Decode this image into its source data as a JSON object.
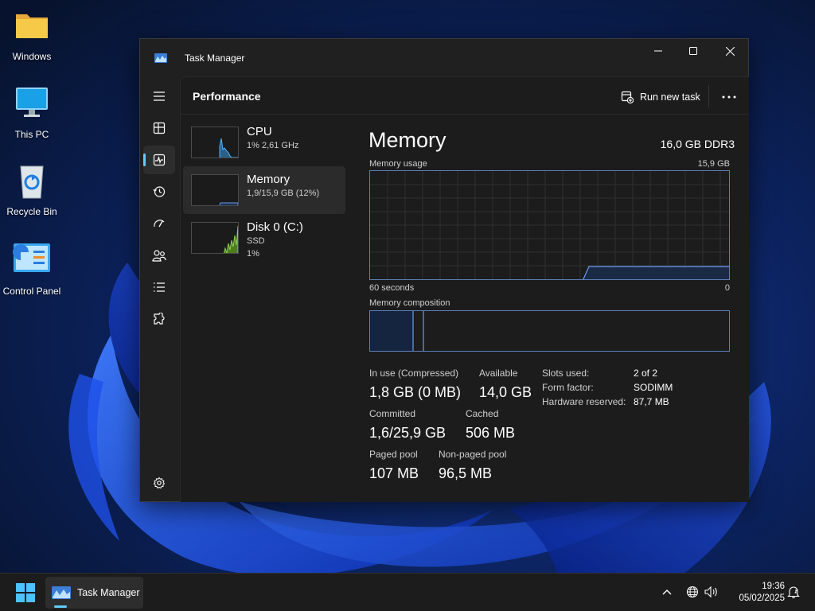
{
  "desktop": {
    "icons": [
      {
        "label": "Windows",
        "icon": "folder-icon"
      },
      {
        "label": "This PC",
        "icon": "monitor-icon"
      },
      {
        "label": "Recycle Bin",
        "icon": "recycle-bin-icon"
      },
      {
        "label": "Control Panel",
        "icon": "control-panel-icon"
      }
    ]
  },
  "window": {
    "title": "Task Manager",
    "page_title": "Performance",
    "run_new_task": "Run new task",
    "nav": [
      "menu-icon",
      "processes-icon",
      "performance-icon",
      "app-history-icon",
      "startup-apps-icon",
      "users-icon",
      "details-icon",
      "services-icon",
      "settings-icon"
    ]
  },
  "perf_list": [
    {
      "name": "CPU",
      "line1": "1% 2,61 GHz",
      "line2": ""
    },
    {
      "name": "Memory",
      "line1": "1,9/15,9 GB (12%)",
      "line2": ""
    },
    {
      "name": "Disk 0 (C:)",
      "line1": "SSD",
      "line2": "1%"
    }
  ],
  "memory": {
    "title": "Memory",
    "type": "16,0 GB DDR3",
    "usage_label": "Memory usage",
    "usage_max": "15,9 GB",
    "axis_left": "60 seconds",
    "axis_right": "0",
    "composition_label": "Memory composition",
    "stats": {
      "in_use_label": "In use (Compressed)",
      "in_use_value": "1,8 GB (0 MB)",
      "available_label": "Available",
      "available_value": "14,0 GB",
      "committed_label": "Committed",
      "committed_value": "1,6/25,9 GB",
      "cached_label": "Cached",
      "cached_value": "506 MB",
      "paged_label": "Paged pool",
      "paged_value": "107 MB",
      "nonpaged_label": "Non-paged pool",
      "nonpaged_value": "96,5 MB"
    },
    "details": {
      "slots_key": "Slots used:",
      "slots_val": "2 of 2",
      "form_key": "Form factor:",
      "form_val": "SODIMM",
      "hw_key": "Hardware reserved:",
      "hw_val": "87,7 MB"
    }
  },
  "taskbar": {
    "app_label": "Task Manager",
    "time": "19:36",
    "date": "05/02/2025"
  },
  "colors": {
    "accent": "#60cdff",
    "graph_border": "#5a7fb8",
    "window_bg": "#202020"
  }
}
